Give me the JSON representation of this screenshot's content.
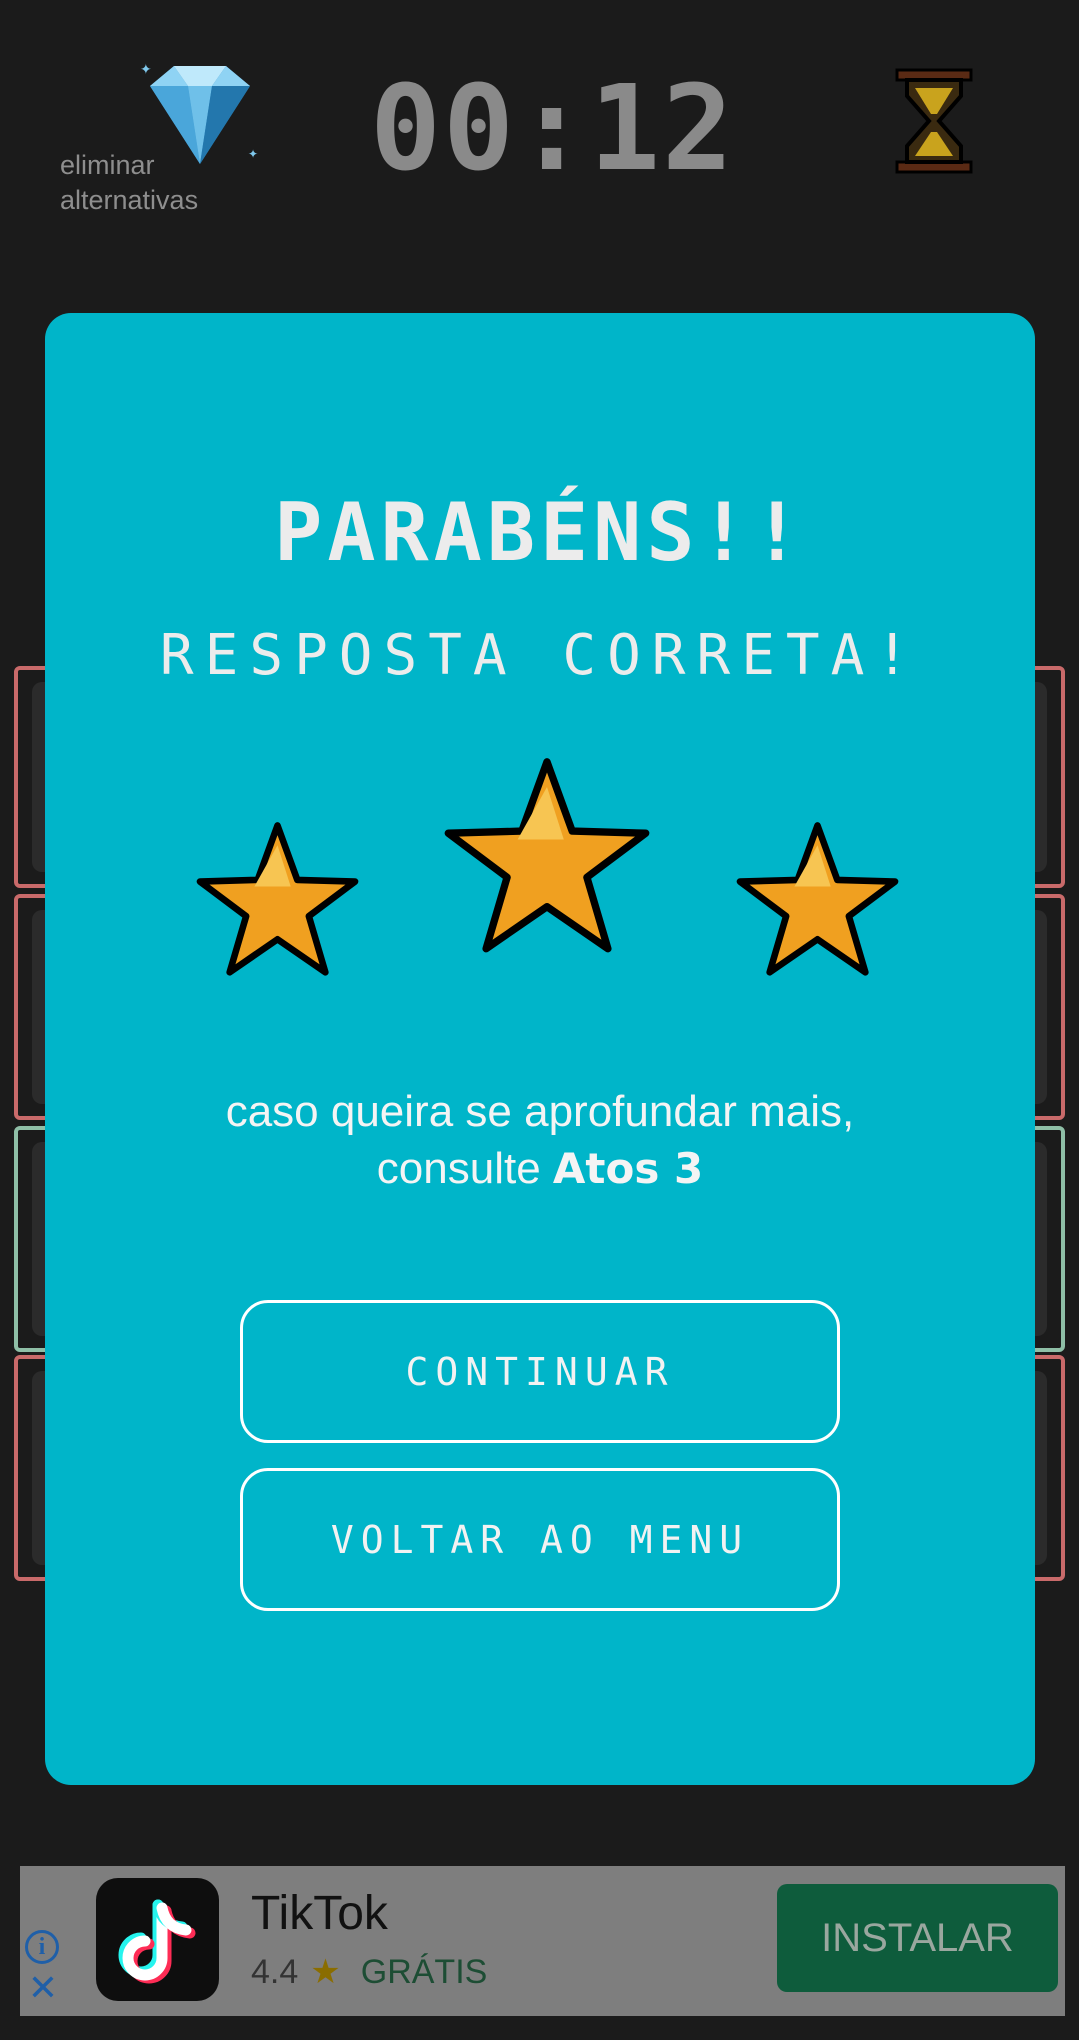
{
  "header": {
    "hint_label": "eliminar\nalternativas",
    "timer": "00:12",
    "icons": {
      "hint": "diamond-icon",
      "timer": "hourglass-icon"
    }
  },
  "answers": {
    "colors": [
      "#c96a6a",
      "#c96a6a",
      "#8fbfa7",
      "#c96a6a"
    ]
  },
  "modal": {
    "title": "PARABÉNS!!",
    "subtitle": "RESPOSTA CORRETA!",
    "stars_earned": 3,
    "stars_total": 3,
    "info_prefix": "caso queira se aprofundar mais,",
    "info_consult": "consulte",
    "info_reference": "Atos 3",
    "continue_label": "CONTINUAR",
    "menu_label": "VOLTAR AO MENU",
    "background": "#00b5c9",
    "star_color": "#f0a020"
  },
  "ad": {
    "app_name": "TikTok",
    "rating": "4.4",
    "price": "GRÁTIS",
    "install_label": "INSTALAR",
    "icons": {
      "info": "info-icon",
      "close": "close-icon",
      "logo": "tiktok-logo-icon",
      "rating": "star-icon"
    }
  }
}
